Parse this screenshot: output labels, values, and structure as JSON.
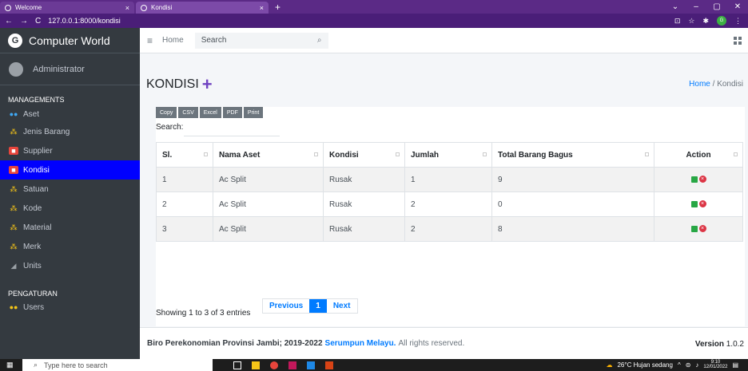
{
  "browser": {
    "tabs": [
      {
        "label": "Welcome",
        "close": "×"
      },
      {
        "label": "Kondisi",
        "close": "×"
      }
    ],
    "new_tab": "+",
    "url": "127.0.0.1:8000/kondisi",
    "window_controls": {
      "minimize": "–",
      "maximize": "▢",
      "close": "✕"
    }
  },
  "sidebar": {
    "brand": "Computer World",
    "brand_logo": "G",
    "user": "Administrator",
    "sections": [
      {
        "title": "MANAGEMENTS",
        "items": [
          {
            "label": "Aset",
            "icon": "users-icon",
            "active": false
          },
          {
            "label": "Jenis Barang",
            "icon": "sitemap-icon",
            "active": false
          },
          {
            "label": "Supplier",
            "icon": "truck-icon",
            "active": false
          },
          {
            "label": "Kondisi",
            "icon": "truck-icon",
            "active": true
          },
          {
            "label": "Satuan",
            "icon": "sitemap-icon",
            "active": false
          },
          {
            "label": "Kode",
            "icon": "sitemap-icon",
            "active": false
          },
          {
            "label": "Material",
            "icon": "sitemap-icon",
            "active": false
          },
          {
            "label": "Merk",
            "icon": "sitemap-icon",
            "active": false
          },
          {
            "label": "Units",
            "icon": "ruler-icon",
            "active": false
          }
        ]
      },
      {
        "title": "PENGATURAN",
        "items": [
          {
            "label": "Users",
            "icon": "users-icon",
            "active": false
          }
        ]
      }
    ]
  },
  "topnav": {
    "home": "Home",
    "search_placeholder": "Search"
  },
  "page": {
    "title": "KONDISI",
    "add_symbol": "+",
    "breadcrumb": {
      "home": "Home",
      "sep": " / ",
      "current": "Kondisi"
    }
  },
  "table_tools": {
    "buttons": [
      "Copy",
      "CSV",
      "Excel",
      "PDF",
      "Print"
    ],
    "search_label": "Search:"
  },
  "table": {
    "columns": [
      "Sl.",
      "Nama Aset",
      "Kondisi",
      "Jumlah",
      "Total Barang Bagus",
      "Action"
    ],
    "rows": [
      {
        "sl": "1",
        "nama": "Ac Split",
        "kondisi": "Rusak",
        "jumlah": "1",
        "total": "9"
      },
      {
        "sl": "2",
        "nama": "Ac Split",
        "kondisi": "Rusak",
        "jumlah": "2",
        "total": "0"
      },
      {
        "sl": "3",
        "nama": "Ac Split",
        "kondisi": "Rusak",
        "jumlah": "2",
        "total": "8"
      }
    ]
  },
  "pagination": {
    "info": "Showing 1 to 3 of 3 entries",
    "previous": "Previous",
    "current": "1",
    "next": "Next"
  },
  "footer": {
    "prefix": "Biro Perekonomian Provinsi Jambi; 2019-2022 ",
    "link": "Serumpun Melayu.",
    "suffix": " All rights reserved.",
    "version_label": "Version",
    "version": "1.0.2"
  },
  "taskbar": {
    "search_placeholder": "Type here to search",
    "weather": "26°C  Hujan sedang",
    "time": "9:10",
    "date": "12/01/2022"
  },
  "colors": {
    "sidebar_bg": "#343a40",
    "active_item": "#0000ff",
    "accent": "#007bff",
    "title_plus": "#6f42c1"
  }
}
